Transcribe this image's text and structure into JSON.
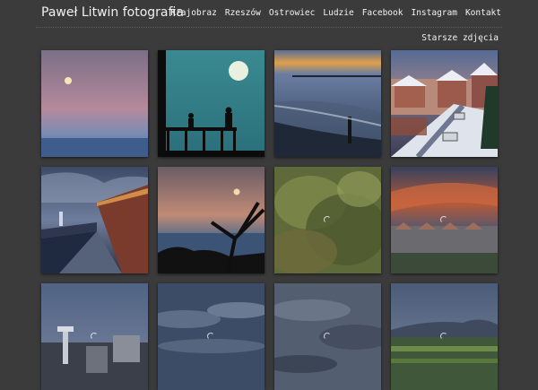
{
  "site": {
    "title": "Paweł Litwin fotografia"
  },
  "nav": {
    "items": [
      {
        "label": "Krajobraz"
      },
      {
        "label": "Rzeszów"
      },
      {
        "label": "Ostrowiec"
      },
      {
        "label": "Ludzie"
      },
      {
        "label": "Facebook"
      },
      {
        "label": "Instagram"
      },
      {
        "label": "Kontakt"
      }
    ]
  },
  "older_link": {
    "label": "Starsze zdjęcia"
  },
  "colors": {
    "background": "#3b3b3b",
    "text": "#f2f2f2"
  }
}
